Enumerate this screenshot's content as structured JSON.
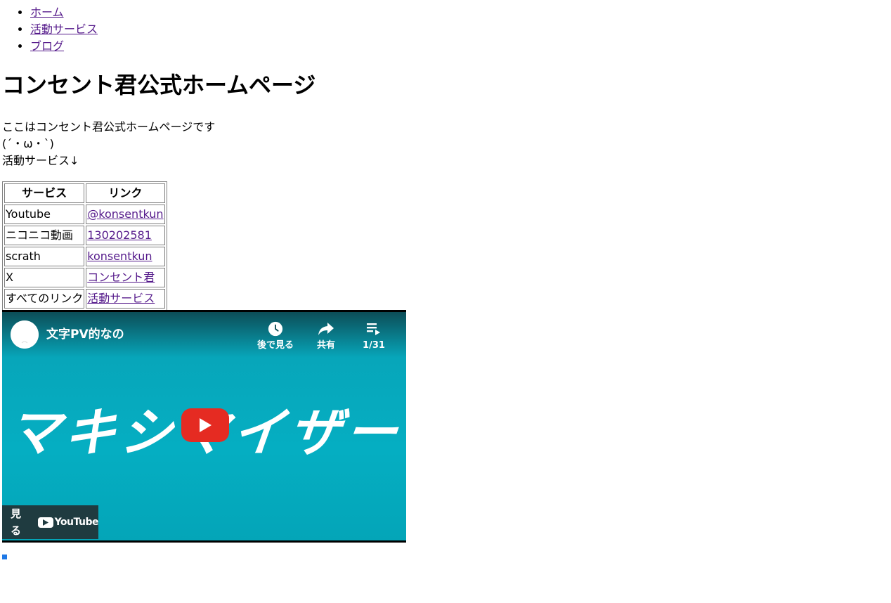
{
  "nav": {
    "items": [
      {
        "label": "ホーム"
      },
      {
        "label": "活動サービス"
      },
      {
        "label": "ブログ"
      }
    ]
  },
  "page": {
    "title": "コンセント君公式ホームページ",
    "intro_lines": [
      "ここはコンセント君公式ホームページです",
      "(´・ω・`)",
      "活動サービス↓"
    ]
  },
  "table": {
    "headers": [
      "サービス",
      "リンク"
    ],
    "rows": [
      {
        "service": "Youtube",
        "link": "@konsentkun"
      },
      {
        "service": "ニコニコ動画",
        "link": "130202581"
      },
      {
        "service": "scrath",
        "link": "konsentkun"
      },
      {
        "service": "X",
        "link": "コンセント君"
      },
      {
        "service": "すべてのリンク",
        "link": "活動サービス"
      }
    ]
  },
  "video": {
    "title": "文字PV的なの",
    "watch_later_label": "後で見る",
    "share_label": "共有",
    "playlist_label": "1/31",
    "thumbnail_text": "マキシマイザー",
    "watch_on_label": "見る",
    "youtube_wordmark": "YouTube",
    "colors": {
      "play": "#e52b22",
      "bg": "#05aec2"
    }
  },
  "icons": {
    "watch_later": "clock-icon",
    "share": "share-arrow-icon",
    "playlist": "playlist-icon",
    "play": "play-icon"
  }
}
